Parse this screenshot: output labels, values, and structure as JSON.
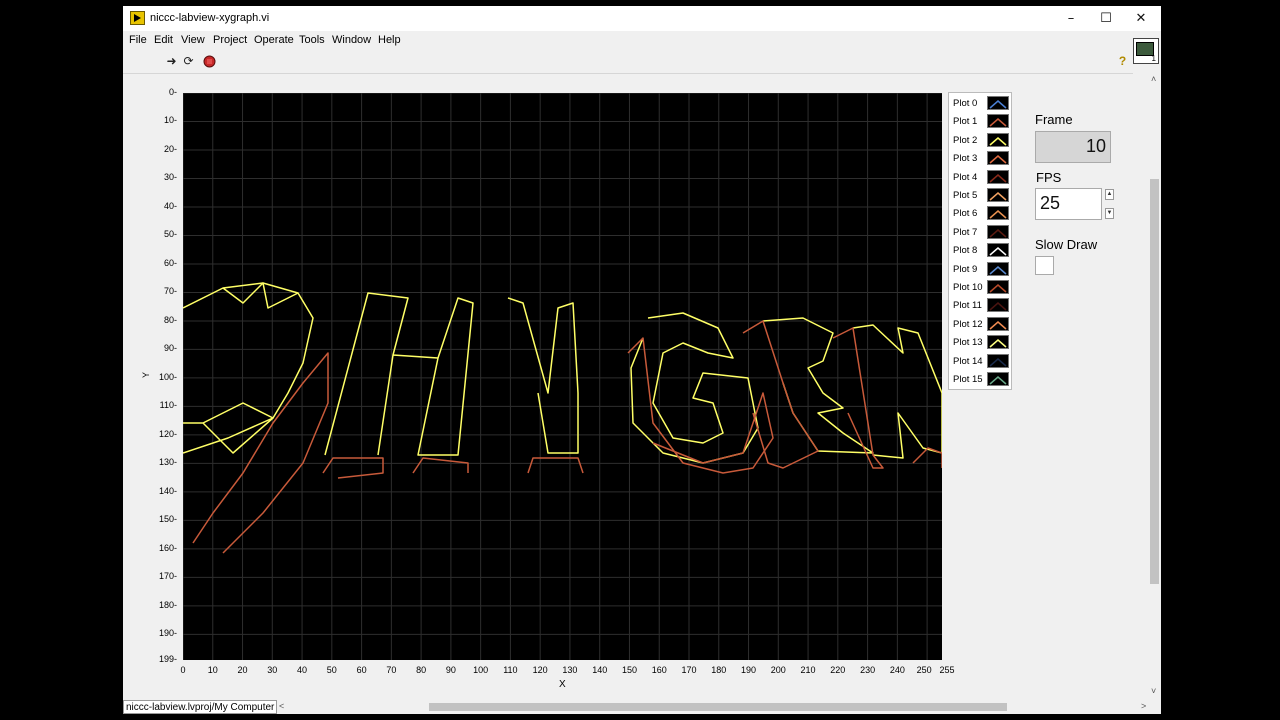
{
  "window": {
    "title": "niccc-labview-xygraph.vi"
  },
  "menu": [
    "File",
    "Edit",
    "View",
    "Project",
    "Operate",
    "Tools",
    "Window",
    "Help"
  ],
  "toolbar": {
    "help_glyph": "?"
  },
  "graph": {
    "xlabel": "X",
    "ylabel": "Y",
    "x_ticks": [
      "0",
      "10",
      "20",
      "30",
      "40",
      "50",
      "60",
      "70",
      "80",
      "90",
      "100",
      "110",
      "120",
      "130",
      "140",
      "150",
      "160",
      "170",
      "180",
      "190",
      "200",
      "210",
      "220",
      "230",
      "240",
      "250",
      "255"
    ],
    "y_ticks": [
      "0",
      "10",
      "20",
      "30",
      "40",
      "50",
      "60",
      "70",
      "80",
      "90",
      "100",
      "110",
      "120",
      "130",
      "140",
      "150",
      "160",
      "170",
      "180",
      "190",
      "199"
    ],
    "colors": {
      "background": "#000000",
      "grid": "#2e2e2e"
    }
  },
  "legend": [
    {
      "name": "Plot 0",
      "color": "#4a7fd4"
    },
    {
      "name": "Plot 1",
      "color": "#c85a3a"
    },
    {
      "name": "Plot 2",
      "color": "#ffff66"
    },
    {
      "name": "Plot 3",
      "color": "#e06a40"
    },
    {
      "name": "Plot 4",
      "color": "#8a2a1a"
    },
    {
      "name": "Plot 5",
      "color": "#f0a060"
    },
    {
      "name": "Plot 6",
      "color": "#e89050"
    },
    {
      "name": "Plot 7",
      "color": "#5a1a10"
    },
    {
      "name": "Plot 8",
      "color": "#ffffff"
    },
    {
      "name": "Plot 9",
      "color": "#5a8ad0"
    },
    {
      "name": "Plot 10",
      "color": "#b84a2a"
    },
    {
      "name": "Plot 11",
      "color": "#4a1410"
    },
    {
      "name": "Plot 12",
      "color": "#f08a50"
    },
    {
      "name": "Plot 13",
      "color": "#ffff80"
    },
    {
      "name": "Plot 14",
      "color": "#1a2a4a"
    },
    {
      "name": "Plot 15",
      "color": "#6aaa8a"
    }
  ],
  "controls": {
    "frame_label": "Frame",
    "frame_value": "10",
    "fps_label": "FPS",
    "fps_value": "25",
    "slow_draw_label": "Slow Draw",
    "slow_draw_checked": false
  },
  "status": {
    "path": "niccc-labview.lvproj/My Computer"
  }
}
